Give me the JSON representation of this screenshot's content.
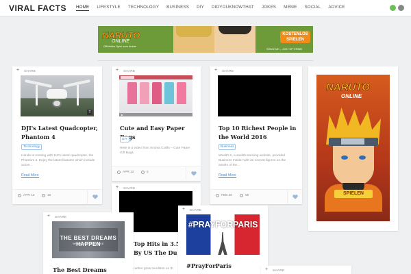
{
  "header": {
    "logo": "VIRAL FACTS",
    "nav": [
      "HOME",
      "LIFESTYLE",
      "TECHNOLOGY",
      "BUSINESS",
      "DIY",
      "DIDYOUKNOWTHAT",
      "JOKES",
      "MEME",
      "SOCIAL",
      "ADVICE"
    ],
    "active_nav": "HOME",
    "icons": [
      "mail-icon",
      "rss-icon"
    ]
  },
  "banner": {
    "logo_line1": "NARUTO",
    "logo_line2": "ONLINE",
    "logo_line3": "Offizielles Spiel zum Anime",
    "cta": "KOSTENLOS SPIELEN",
    "copyright": "©2002 MK – 2007 SP ©RNEI"
  },
  "share_label": "SHARE",
  "cards": [
    {
      "title": "DJI's Latest Quadcopter, Phantom 4",
      "tag": "Technology",
      "excerpt": "Hands-on testing with DJI's latest quadcopter, the Phantom 4. Enjoy the latest features which include active...",
      "read_more": "Read More",
      "date": "APR 12",
      "views": "10"
    },
    {
      "title": "Cute and Easy Paper Bags",
      "tag": "DIY",
      "excerpt": "Here is a video from Innova Crafts – Cute Paper Gift Bags.",
      "date": "APR 12",
      "views": "6"
    },
    {
      "title": "Top 10 Richest People in the World 2016",
      "tag": "Business",
      "excerpt": "Wealth X, a wealth-tracking website, provided Business Insider with its newest figures on the assets of the...",
      "read_more": "Read More",
      "date": "FEB 20",
      "views": "59"
    },
    {
      "title_partial": "Top Hits in 3.5 tes By US The Du",
      "excerpt_partial": "nother great rendition on th"
    },
    {
      "title": "The Best Dreams Happen",
      "thumb_line1": "BEST DREAMS HAPPEN",
      "thumb_line1_prefix": "THE",
      "thumb_line2": "WHEN YOU'RE AWAKE"
    },
    {
      "title": "#PrayForParis",
      "thumb_text": "#PRAYFORPARIS"
    }
  ],
  "side_ad": {
    "logo": "NARUTO",
    "sub": "ONLINE",
    "cta": "SPIELEN"
  },
  "colors": {
    "accent": "#4a8fd1",
    "page_bg": "#eef0f2"
  }
}
